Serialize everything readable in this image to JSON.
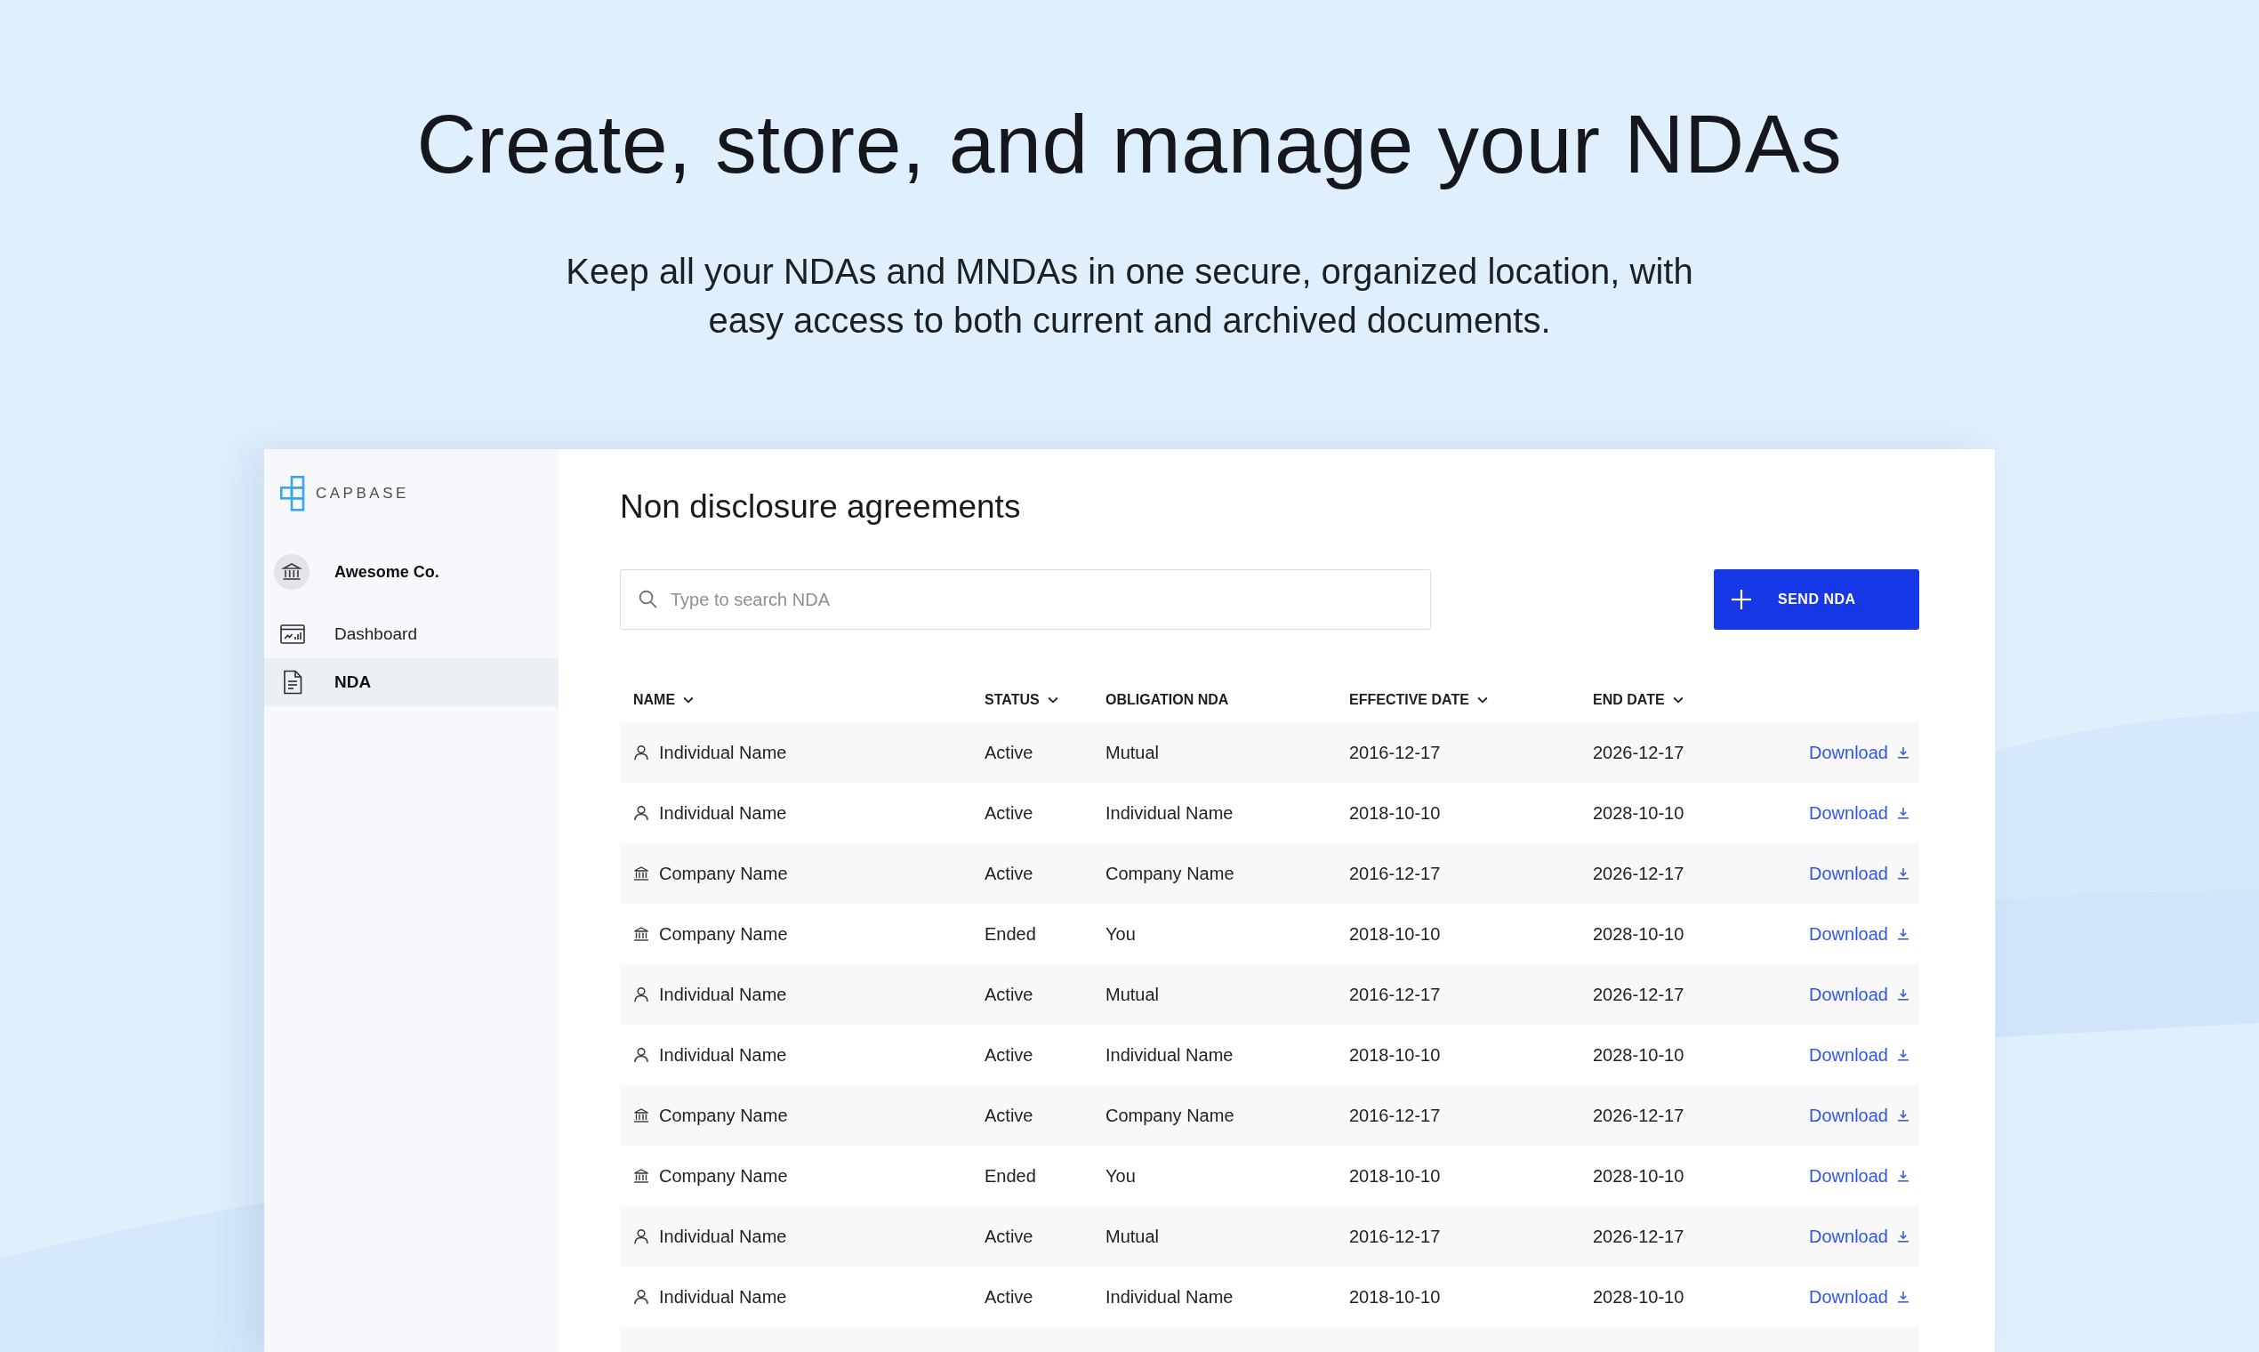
{
  "hero": {
    "title": "Create, store, and manage your NDAs",
    "subtitle": "Keep all your NDAs and MNDAs in one secure, organized location, with easy access to both current and archived documents."
  },
  "sidebar": {
    "logo_text": "CAPBASE",
    "account": {
      "name": "Awesome Co."
    },
    "items": [
      {
        "label": "Dashboard",
        "kind": "dashboard",
        "selected": false
      },
      {
        "label": "NDA",
        "kind": "document",
        "selected": true
      }
    ]
  },
  "main": {
    "title": "Non disclosure agreements",
    "search": {
      "placeholder": "Type to search NDA"
    },
    "send_button": {
      "label": "SEND NDA"
    }
  },
  "table": {
    "columns": [
      {
        "label": "NAME",
        "sortable": true
      },
      {
        "label": "STATUS",
        "sortable": true
      },
      {
        "label": "OBLIGATION NDA",
        "sortable": false
      },
      {
        "label": "EFFECTIVE DATE",
        "sortable": true
      },
      {
        "label": "END DATE",
        "sortable": true
      }
    ],
    "rows": [
      {
        "kind": "individual",
        "name": "Individual Name",
        "status": "Active",
        "obligation": "Mutual",
        "effective_date": "2016-12-17",
        "end_date": "2026-12-17",
        "action": "Download"
      },
      {
        "kind": "individual",
        "name": "Individual Name",
        "status": "Active",
        "obligation": "Individual Name",
        "effective_date": "2018-10-10",
        "end_date": "2028-10-10",
        "action": "Download"
      },
      {
        "kind": "company",
        "name": "Company Name",
        "status": "Active",
        "obligation": "Company Name",
        "effective_date": "2016-12-17",
        "end_date": "2026-12-17",
        "action": "Download"
      },
      {
        "kind": "company",
        "name": "Company Name",
        "status": "Ended",
        "obligation": "You",
        "effective_date": "2018-10-10",
        "end_date": "2028-10-10",
        "action": "Download"
      },
      {
        "kind": "individual",
        "name": "Individual Name",
        "status": "Active",
        "obligation": "Mutual",
        "effective_date": "2016-12-17",
        "end_date": "2026-12-17",
        "action": "Download"
      },
      {
        "kind": "individual",
        "name": "Individual Name",
        "status": "Active",
        "obligation": "Individual Name",
        "effective_date": "2018-10-10",
        "end_date": "2028-10-10",
        "action": "Download"
      },
      {
        "kind": "company",
        "name": "Company Name",
        "status": "Active",
        "obligation": "Company Name",
        "effective_date": "2016-12-17",
        "end_date": "2026-12-17",
        "action": "Download"
      },
      {
        "kind": "company",
        "name": "Company Name",
        "status": "Ended",
        "obligation": "You",
        "effective_date": "2018-10-10",
        "end_date": "2028-10-10",
        "action": "Download"
      },
      {
        "kind": "individual",
        "name": "Individual Name",
        "status": "Active",
        "obligation": "Mutual",
        "effective_date": "2016-12-17",
        "end_date": "2026-12-17",
        "action": "Download"
      },
      {
        "kind": "individual",
        "name": "Individual Name",
        "status": "Active",
        "obligation": "Individual Name",
        "effective_date": "2018-10-10",
        "end_date": "2028-10-10",
        "action": "Download"
      }
    ]
  }
}
